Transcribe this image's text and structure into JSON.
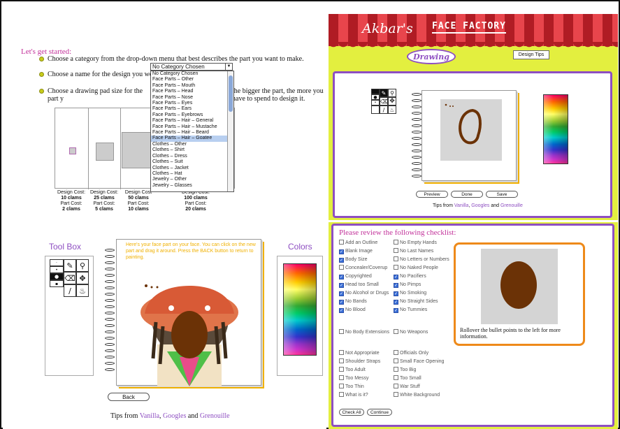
{
  "setup": {
    "heading": "Let's get started:",
    "step1": "Choose a category from the drop-down menu that best describes the part you want to make.",
    "step2": "Choose a name for the design you woul",
    "step3a": "Choose a drawing pad size for the part y",
    "step3b": "the bigger the part, the more you have to spend to design it.",
    "category_select": {
      "value": "No Category Chosen"
    },
    "category_options": [
      "No Category Chosen",
      "Face Parts – Other",
      "Face Parts – Mouth",
      "Face Parts – Head",
      "Face Parts – Nose",
      "Face Parts – Eyes",
      "Face Parts – Ears",
      "Face Parts – Eyebrows",
      "Face Parts – Hair – General",
      "Face Parts – Hair – Mustache",
      "Face Parts – Hair – Beard",
      "Face Parts – Hair – Goatee",
      "Clothes – Other",
      "Clothes – Shirt",
      "Clothes – Dress",
      "Clothes – Suit",
      "Clothes – Jacket",
      "Clothes – Hat",
      "Jewelry – Other",
      "Jewelry – Glasses"
    ],
    "selected_option": "Face Parts – Hair – Goatee",
    "pad_costs": [
      {
        "design_label": "Design Cost:",
        "design": "10 clams",
        "part_label": "Part Cost:",
        "part": "2 clams"
      },
      {
        "design_label": "Design Cost:",
        "design": "25 clams",
        "part_label": "Part Cost:",
        "part": "5 clams"
      },
      {
        "design_label": "Design Cost",
        "design": "50 clams",
        "part_label": "Part Cost:",
        "part": "10 clams"
      },
      {
        "design_label": "Design Cost:",
        "design": "100 clams",
        "part_label": "Part Cost:",
        "part": "20 clams"
      }
    ]
  },
  "drawing": {
    "logo_script": "Akbar's",
    "logo_title": "FACE FACTORY",
    "tab_drawing": "Drawing",
    "tab_design_tips": "Design Tips",
    "buttons": {
      "preview": "Preview",
      "done": "Done",
      "save": "Save"
    },
    "tips_prefix": "Tips from",
    "tips_names": [
      "Vanilla",
      "Googles",
      "Grenouille"
    ],
    "tips_sep": ",",
    "tips_and": "and"
  },
  "toolbox": {
    "title": "Tool Box",
    "colors_title": "Colors",
    "notice": "Here's your face part on your face. You can click on the new part and drag it around. Press the BACK button to return to painting.",
    "back": "Back",
    "tips_prefix": "Tips from",
    "tips_names": [
      "Vanilla",
      "Googles",
      "Grenouille"
    ],
    "tips_sep": ",",
    "tips_and": "and"
  },
  "checklist": {
    "title": "Please review the following checklist:",
    "left": [
      {
        "label": "Add an Outline",
        "checked": false
      },
      {
        "label": "Blank Image",
        "checked": true
      },
      {
        "label": "Body Size",
        "checked": true
      },
      {
        "label": "Concealer/Coverup",
        "checked": false
      },
      {
        "label": "Copyrighted",
        "checked": true
      },
      {
        "label": "Head too Small",
        "checked": true
      },
      {
        "label": "No Alcohol or Drugs",
        "checked": true
      },
      {
        "label": "No Bands",
        "checked": true
      },
      {
        "label": "No Blood",
        "checked": true
      }
    ],
    "right": [
      {
        "label": "No Empty Hands",
        "checked": false
      },
      {
        "label": "No Last Names",
        "checked": false
      },
      {
        "label": "No Letters or Numbers",
        "checked": false
      },
      {
        "label": "No Naked People",
        "checked": false
      },
      {
        "label": "No Pacifiers",
        "checked": true
      },
      {
        "label": "No Pimps",
        "checked": true
      },
      {
        "label": "No Smoking",
        "checked": true
      },
      {
        "label": "No Straight Sides",
        "checked": true
      },
      {
        "label": "No Tummies",
        "checked": true
      }
    ],
    "mid_left": {
      "label": "No Body Extensions",
      "checked": false
    },
    "mid_right": {
      "label": "No Weapons",
      "checked": false
    },
    "lower_left": [
      "Not Appropriate",
      "Shoulder Straps",
      "Too Adult",
      "Too Messy",
      "Too Thin",
      "What is it?"
    ],
    "lower_right": [
      "Officials Only",
      "Small Face Opening",
      "Too Big",
      "Too Small",
      "War Stuff",
      "White Background"
    ],
    "preview_text": "Rollover the bullet points to the left for more information.",
    "btn_check_all": "Check All",
    "btn_continue": "Continue"
  },
  "colors": {
    "purple": "#8e4fc2",
    "pink": "#c2319a",
    "lime": "#e3ef3f",
    "orange": "#ee8a1a",
    "brown": "#6b3206"
  }
}
